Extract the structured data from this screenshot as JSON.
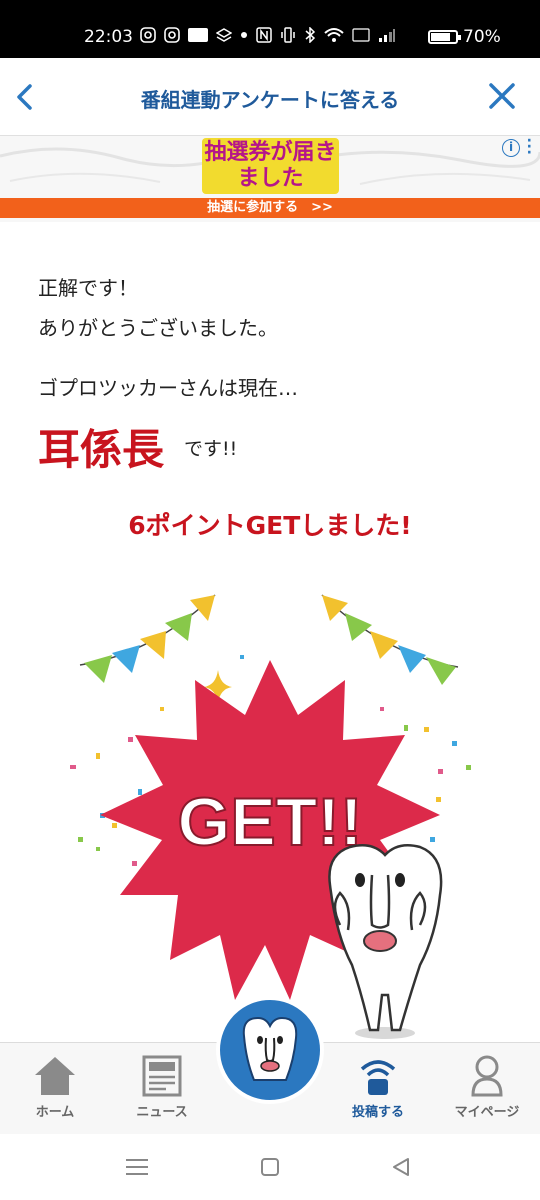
{
  "status_bar": {
    "time": "22:03",
    "battery": "70%"
  },
  "header": {
    "title": "番組連動アンケートに答える"
  },
  "ad": {
    "headline": "抽選券が届きました",
    "cta": "抽選に参加する　>>"
  },
  "result": {
    "line1": "正解です！",
    "line2": "ありがとうございました。",
    "line3": "ゴプロツッカーさんは現在…",
    "rank": "耳係長",
    "rank_suffix": "です!!",
    "points": "6ポイントGETしました!"
  },
  "art": {
    "get_text": "GET!!"
  },
  "tabs": [
    {
      "label": "ホーム"
    },
    {
      "label": "ニュース"
    },
    {
      "label": "投稿する"
    },
    {
      "label": "マイページ"
    }
  ],
  "colors": {
    "accent_blue": "#1f5a9b",
    "accent_red": "#c8141e",
    "ad_orange": "#f2611b",
    "burst_red": "#dc2a4a"
  }
}
